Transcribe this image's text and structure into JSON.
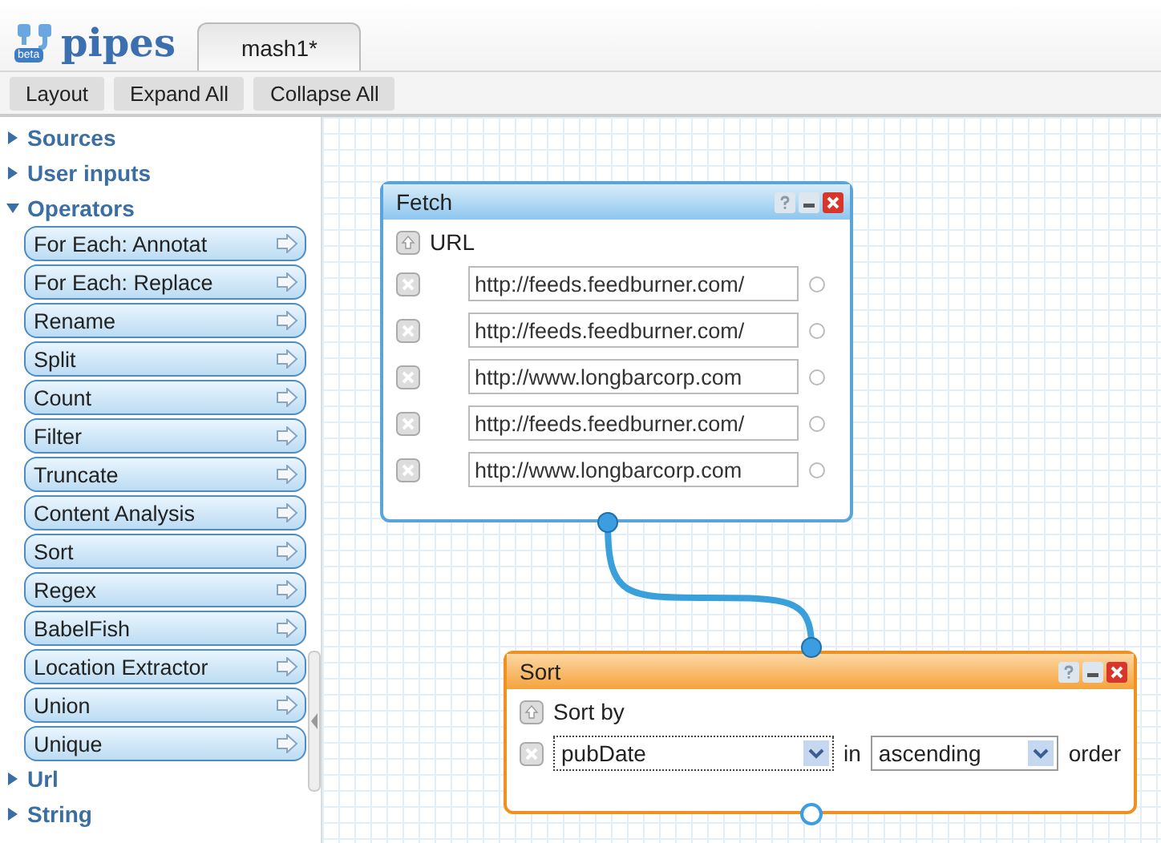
{
  "header": {
    "logo": "pipes",
    "logo_badge": "beta",
    "tabs": [
      {
        "label": "mash1*",
        "selected": true
      }
    ]
  },
  "toolbar": [
    "Layout",
    "Expand All",
    "Collapse All"
  ],
  "library": [
    {
      "label": "Sources",
      "expanded": false
    },
    {
      "label": "User inputs",
      "expanded": false
    },
    {
      "label": "Operators",
      "expanded": true,
      "children": [
        "For Each: Annotat",
        "For Each: Replace",
        "Rename",
        "Split",
        "Count",
        "Filter",
        "Truncate",
        "Content Analysis",
        "Sort",
        "Regex",
        "BabelFish",
        "Location Extractor",
        "Union",
        "Unique"
      ]
    },
    {
      "label": "Url",
      "expanded": false
    },
    {
      "label": "String",
      "expanded": false
    }
  ],
  "modules": [
    {
      "kind": "fetch",
      "title": "Fetch",
      "selected": false,
      "field_label": "URL",
      "values": [
        "http://feeds.feedburner.com/",
        "http://feeds.feedburner.com/",
        "http://www.longbarcorp.com",
        "http://feeds.feedburner.com/",
        "http://www.longbarcorp.com"
      ]
    },
    {
      "kind": "sort",
      "title": "Sort",
      "selected": true,
      "field_label": "Sort by",
      "key": "pubDate",
      "connector": "in",
      "direction": "ascending",
      "suffix": "order"
    }
  ]
}
